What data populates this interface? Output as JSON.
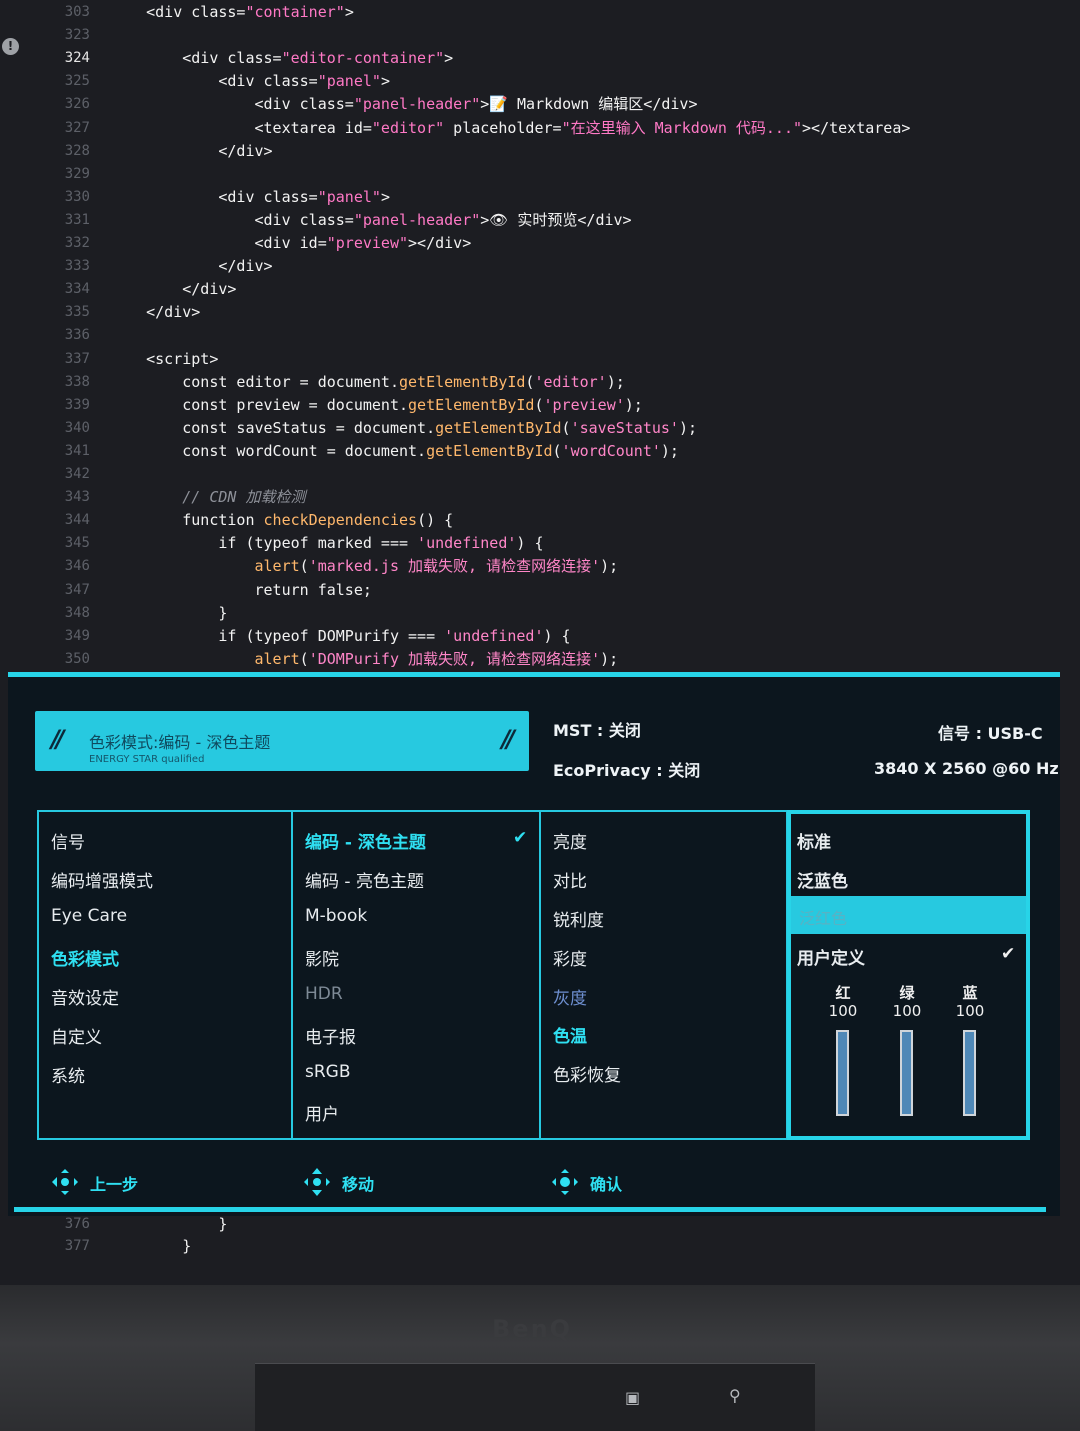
{
  "editor": {
    "lines": [
      {
        "n": "303",
        "code": "    <div class=\"container\">"
      },
      {
        "n": "323",
        "code": ""
      },
      {
        "n": "324",
        "code": "        <div class=\"editor-container\">"
      },
      {
        "n": "325",
        "code": "            <div class=\"panel\">"
      },
      {
        "n": "326",
        "code": "                <div class=\"panel-header\">📝 Markdown 编辑区</div>"
      },
      {
        "n": "327",
        "code": "                <textarea id=\"editor\" placeholder=\"在这里输入 Markdown 代码...\"></textarea>"
      },
      {
        "n": "328",
        "code": "            </div>"
      },
      {
        "n": "329",
        "code": ""
      },
      {
        "n": "330",
        "code": "            <div class=\"panel\">"
      },
      {
        "n": "331",
        "code": "                <div class=\"panel-header\">👁 实时预览</div>"
      },
      {
        "n": "332",
        "code": "                <div id=\"preview\"></div>"
      },
      {
        "n": "333",
        "code": "            </div>"
      },
      {
        "n": "334",
        "code": "        </div>"
      },
      {
        "n": "335",
        "code": "    </div>"
      },
      {
        "n": "336",
        "code": ""
      },
      {
        "n": "337",
        "code": "    <script>"
      },
      {
        "n": "338",
        "code": "        const editor = document.getElementById('editor');"
      },
      {
        "n": "339",
        "code": "        const preview = document.getElementById('preview');"
      },
      {
        "n": "340",
        "code": "        const saveStatus = document.getElementById('saveStatus');"
      },
      {
        "n": "341",
        "code": "        const wordCount = document.getElementById('wordCount');"
      },
      {
        "n": "342",
        "code": ""
      },
      {
        "n": "343",
        "code": "        // CDN 加载检测"
      },
      {
        "n": "344",
        "code": "        function checkDependencies() {"
      },
      {
        "n": "345",
        "code": "            if (typeof marked === 'undefined') {"
      },
      {
        "n": "346",
        "code": "                alert('marked.js 加载失败, 请检查网络连接');"
      },
      {
        "n": "347",
        "code": "                return false;"
      },
      {
        "n": "348",
        "code": "            }"
      },
      {
        "n": "349",
        "code": "            if (typeof DOMPurify === 'undefined') {"
      },
      {
        "n": "350",
        "code": "                alert('DOMPurify 加载失败, 请检查网络连接');"
      }
    ],
    "tail_lines": [
      {
        "n": "376",
        "code": "            }"
      },
      {
        "n": "377",
        "code": "        }"
      }
    ]
  },
  "osd": {
    "mode_banner": {
      "text": "色彩模式:编码 - 深色主题",
      "sub": "ENERGY STAR qualified"
    },
    "mst": "MST : 关闭",
    "ecoprivacy": "EcoPrivacy : 关闭",
    "signal": "信号 : USB-C",
    "resolution": "3840 X 2560 @60 Hz",
    "main_menu": [
      "信号",
      "编码增强模式",
      "Eye Care",
      "色彩模式",
      "音效设定",
      "自定义",
      "系统"
    ],
    "color_modes": [
      "编码 - 深色主题",
      "编码 - 亮色主题",
      "M-book",
      "影院",
      "HDR",
      "电子报",
      "sRGB",
      "用户"
    ],
    "adjust_menu": [
      "亮度",
      "对比",
      "锐利度",
      "彩度",
      "灰度",
      "色温",
      "色彩恢复"
    ],
    "temp_options": [
      "标准",
      "泛蓝色",
      "泛红色",
      "用户定义"
    ],
    "rgb": [
      {
        "label": "红",
        "value": "100"
      },
      {
        "label": "绿",
        "value": "100"
      },
      {
        "label": "蓝",
        "value": "100"
      }
    ],
    "nav": {
      "back": "上一步",
      "move": "移动",
      "confirm": "确认"
    },
    "accent": "#27d4e8"
  },
  "bezel": {
    "brand": "BenQ"
  }
}
